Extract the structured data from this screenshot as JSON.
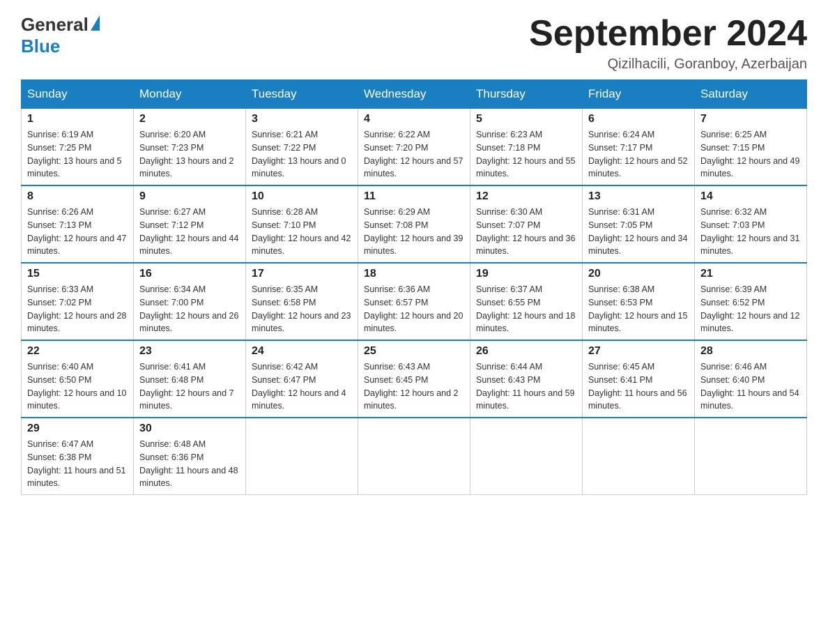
{
  "header": {
    "logo_general": "General",
    "logo_blue": "Blue",
    "month_title": "September 2024",
    "location": "Qizilhacili, Goranboy, Azerbaijan"
  },
  "days_of_week": [
    "Sunday",
    "Monday",
    "Tuesday",
    "Wednesday",
    "Thursday",
    "Friday",
    "Saturday"
  ],
  "weeks": [
    [
      {
        "day": "1",
        "sunrise": "6:19 AM",
        "sunset": "7:25 PM",
        "daylight": "13 hours and 5 minutes."
      },
      {
        "day": "2",
        "sunrise": "6:20 AM",
        "sunset": "7:23 PM",
        "daylight": "13 hours and 2 minutes."
      },
      {
        "day": "3",
        "sunrise": "6:21 AM",
        "sunset": "7:22 PM",
        "daylight": "13 hours and 0 minutes."
      },
      {
        "day": "4",
        "sunrise": "6:22 AM",
        "sunset": "7:20 PM",
        "daylight": "12 hours and 57 minutes."
      },
      {
        "day": "5",
        "sunrise": "6:23 AM",
        "sunset": "7:18 PM",
        "daylight": "12 hours and 55 minutes."
      },
      {
        "day": "6",
        "sunrise": "6:24 AM",
        "sunset": "7:17 PM",
        "daylight": "12 hours and 52 minutes."
      },
      {
        "day": "7",
        "sunrise": "6:25 AM",
        "sunset": "7:15 PM",
        "daylight": "12 hours and 49 minutes."
      }
    ],
    [
      {
        "day": "8",
        "sunrise": "6:26 AM",
        "sunset": "7:13 PM",
        "daylight": "12 hours and 47 minutes."
      },
      {
        "day": "9",
        "sunrise": "6:27 AM",
        "sunset": "7:12 PM",
        "daylight": "12 hours and 44 minutes."
      },
      {
        "day": "10",
        "sunrise": "6:28 AM",
        "sunset": "7:10 PM",
        "daylight": "12 hours and 42 minutes."
      },
      {
        "day": "11",
        "sunrise": "6:29 AM",
        "sunset": "7:08 PM",
        "daylight": "12 hours and 39 minutes."
      },
      {
        "day": "12",
        "sunrise": "6:30 AM",
        "sunset": "7:07 PM",
        "daylight": "12 hours and 36 minutes."
      },
      {
        "day": "13",
        "sunrise": "6:31 AM",
        "sunset": "7:05 PM",
        "daylight": "12 hours and 34 minutes."
      },
      {
        "day": "14",
        "sunrise": "6:32 AM",
        "sunset": "7:03 PM",
        "daylight": "12 hours and 31 minutes."
      }
    ],
    [
      {
        "day": "15",
        "sunrise": "6:33 AM",
        "sunset": "7:02 PM",
        "daylight": "12 hours and 28 minutes."
      },
      {
        "day": "16",
        "sunrise": "6:34 AM",
        "sunset": "7:00 PM",
        "daylight": "12 hours and 26 minutes."
      },
      {
        "day": "17",
        "sunrise": "6:35 AM",
        "sunset": "6:58 PM",
        "daylight": "12 hours and 23 minutes."
      },
      {
        "day": "18",
        "sunrise": "6:36 AM",
        "sunset": "6:57 PM",
        "daylight": "12 hours and 20 minutes."
      },
      {
        "day": "19",
        "sunrise": "6:37 AM",
        "sunset": "6:55 PM",
        "daylight": "12 hours and 18 minutes."
      },
      {
        "day": "20",
        "sunrise": "6:38 AM",
        "sunset": "6:53 PM",
        "daylight": "12 hours and 15 minutes."
      },
      {
        "day": "21",
        "sunrise": "6:39 AM",
        "sunset": "6:52 PM",
        "daylight": "12 hours and 12 minutes."
      }
    ],
    [
      {
        "day": "22",
        "sunrise": "6:40 AM",
        "sunset": "6:50 PM",
        "daylight": "12 hours and 10 minutes."
      },
      {
        "day": "23",
        "sunrise": "6:41 AM",
        "sunset": "6:48 PM",
        "daylight": "12 hours and 7 minutes."
      },
      {
        "day": "24",
        "sunrise": "6:42 AM",
        "sunset": "6:47 PM",
        "daylight": "12 hours and 4 minutes."
      },
      {
        "day": "25",
        "sunrise": "6:43 AM",
        "sunset": "6:45 PM",
        "daylight": "12 hours and 2 minutes."
      },
      {
        "day": "26",
        "sunrise": "6:44 AM",
        "sunset": "6:43 PM",
        "daylight": "11 hours and 59 minutes."
      },
      {
        "day": "27",
        "sunrise": "6:45 AM",
        "sunset": "6:41 PM",
        "daylight": "11 hours and 56 minutes."
      },
      {
        "day": "28",
        "sunrise": "6:46 AM",
        "sunset": "6:40 PM",
        "daylight": "11 hours and 54 minutes."
      }
    ],
    [
      {
        "day": "29",
        "sunrise": "6:47 AM",
        "sunset": "6:38 PM",
        "daylight": "11 hours and 51 minutes."
      },
      {
        "day": "30",
        "sunrise": "6:48 AM",
        "sunset": "6:36 PM",
        "daylight": "11 hours and 48 minutes."
      },
      null,
      null,
      null,
      null,
      null
    ]
  ]
}
